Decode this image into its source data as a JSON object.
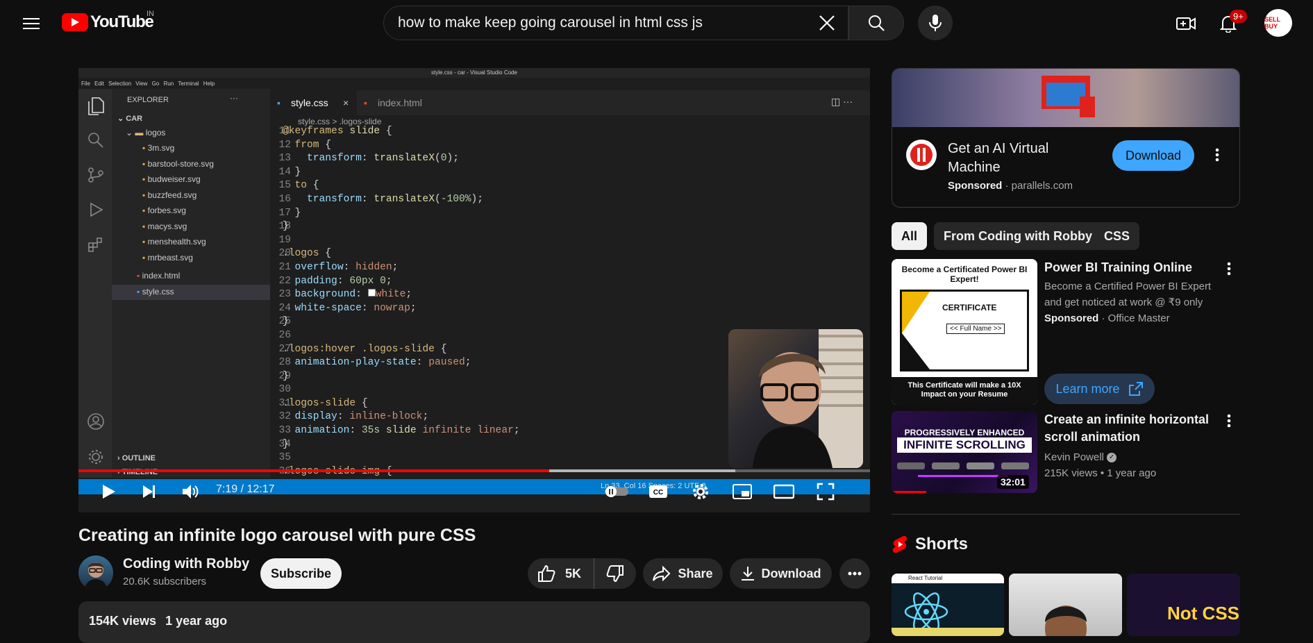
{
  "header": {
    "country_code": "IN",
    "search_query": "how to make keep going carousel in html css js",
    "notification_count": "9+",
    "avatar_text": "SELL BUY"
  },
  "player": {
    "vscode": {
      "window_title": "style.css - car - Visual Studio Code",
      "menu": "File Edit Selection View Go Run Terminal Help",
      "explorer_label": "EXPLORER",
      "folder_root": "CAR",
      "folder_logos": "logos",
      "files": [
        "3m.svg",
        "barstool-store.svg",
        "budweiser.svg",
        "buzzfeed.svg",
        "forbes.svg",
        "macys.svg",
        "menshealth.svg",
        "mrbeast.svg"
      ],
      "root_files": [
        "index.html",
        "style.css"
      ],
      "tab_active": "style.css",
      "tab_other": "index.html",
      "breadcrumb": "style.css > .logos-slide",
      "outline": "OUTLINE",
      "timeline": "TIMELINE",
      "line_numbers": "11\n12\n13\n14\n15\n16\n17\n18\n19\n20\n21\n22\n23\n24\n25\n26\n27\n28\n29\n30\n31\n32\n33\n34\n35\n36",
      "status_right": "Ln 33, Col 16   Spaces: 2   UTF-8"
    },
    "current_time": "7:19",
    "total_time": "12:17",
    "time_display": "7:19 / 12:17",
    "progress_fraction": 0.595
  },
  "video": {
    "title": "Creating an infinite logo carousel with pure CSS",
    "channel_name": "Coding with Robby",
    "subscribers": "20.6K subscribers",
    "subscribe_label": "Subscribe",
    "likes": "5K",
    "share_label": "Share",
    "download_label": "Download",
    "views": "154K views",
    "age": "1 year ago"
  },
  "ad": {
    "title": "Get an AI Virtual Machine",
    "sponsored_label": "Sponsored",
    "domain": "· parallels.com",
    "button": "Download"
  },
  "chips": [
    "All",
    "From Coding with Robby",
    "CSS"
  ],
  "recommendations": [
    {
      "thumb_heading": "Become a Certificated Power BI Expert!",
      "thumb_cert": "CERTIFICATE",
      "thumb_name": "<< Full Name >>",
      "thumb_footer": "This Certificate will make a 10X Impact on your Resume",
      "title": "Power BI Training Online",
      "desc": "Become a Certified Power BI Expert and get noticed at work @ ₹9 only",
      "sponsored": "Sponsored",
      "advertiser": "· Office Master",
      "cta": "Learn more"
    },
    {
      "thumb_top": "PROGRESSIVELY ENHANCED",
      "thumb_main": "INFINITE SCROLLING",
      "duration": "32:01",
      "title": "Create an infinite horizontal scroll animation",
      "channel": "Kevin Powell",
      "meta": "215K views  •  1 year ago"
    }
  ],
  "shorts": {
    "label": "Shorts",
    "items": [
      "React Tutorial",
      "",
      "Not CSS"
    ]
  }
}
